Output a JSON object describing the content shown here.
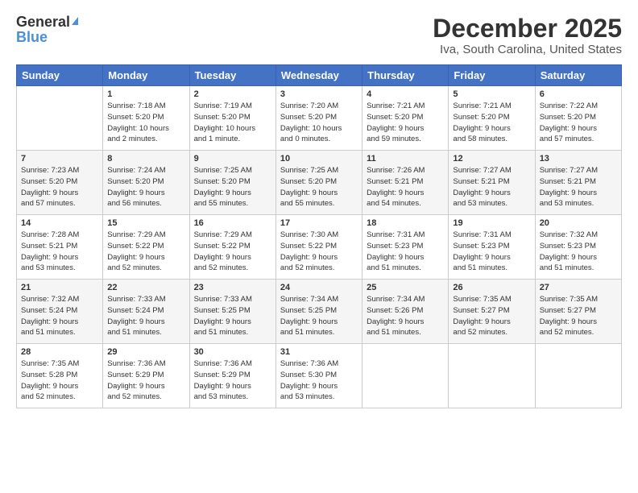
{
  "logo": {
    "general": "General",
    "blue": "Blue"
  },
  "title": "December 2025",
  "location": "Iva, South Carolina, United States",
  "days_of_week": [
    "Sunday",
    "Monday",
    "Tuesday",
    "Wednesday",
    "Thursday",
    "Friday",
    "Saturday"
  ],
  "weeks": [
    [
      {
        "day": "",
        "info": ""
      },
      {
        "day": "1",
        "info": "Sunrise: 7:18 AM\nSunset: 5:20 PM\nDaylight: 10 hours\nand 2 minutes."
      },
      {
        "day": "2",
        "info": "Sunrise: 7:19 AM\nSunset: 5:20 PM\nDaylight: 10 hours\nand 1 minute."
      },
      {
        "day": "3",
        "info": "Sunrise: 7:20 AM\nSunset: 5:20 PM\nDaylight: 10 hours\nand 0 minutes."
      },
      {
        "day": "4",
        "info": "Sunrise: 7:21 AM\nSunset: 5:20 PM\nDaylight: 9 hours\nand 59 minutes."
      },
      {
        "day": "5",
        "info": "Sunrise: 7:21 AM\nSunset: 5:20 PM\nDaylight: 9 hours\nand 58 minutes."
      },
      {
        "day": "6",
        "info": "Sunrise: 7:22 AM\nSunset: 5:20 PM\nDaylight: 9 hours\nand 57 minutes."
      }
    ],
    [
      {
        "day": "7",
        "info": "Sunrise: 7:23 AM\nSunset: 5:20 PM\nDaylight: 9 hours\nand 57 minutes."
      },
      {
        "day": "8",
        "info": "Sunrise: 7:24 AM\nSunset: 5:20 PM\nDaylight: 9 hours\nand 56 minutes."
      },
      {
        "day": "9",
        "info": "Sunrise: 7:25 AM\nSunset: 5:20 PM\nDaylight: 9 hours\nand 55 minutes."
      },
      {
        "day": "10",
        "info": "Sunrise: 7:25 AM\nSunset: 5:20 PM\nDaylight: 9 hours\nand 55 minutes."
      },
      {
        "day": "11",
        "info": "Sunrise: 7:26 AM\nSunset: 5:21 PM\nDaylight: 9 hours\nand 54 minutes."
      },
      {
        "day": "12",
        "info": "Sunrise: 7:27 AM\nSunset: 5:21 PM\nDaylight: 9 hours\nand 53 minutes."
      },
      {
        "day": "13",
        "info": "Sunrise: 7:27 AM\nSunset: 5:21 PM\nDaylight: 9 hours\nand 53 minutes."
      }
    ],
    [
      {
        "day": "14",
        "info": "Sunrise: 7:28 AM\nSunset: 5:21 PM\nDaylight: 9 hours\nand 53 minutes."
      },
      {
        "day": "15",
        "info": "Sunrise: 7:29 AM\nSunset: 5:22 PM\nDaylight: 9 hours\nand 52 minutes."
      },
      {
        "day": "16",
        "info": "Sunrise: 7:29 AM\nSunset: 5:22 PM\nDaylight: 9 hours\nand 52 minutes."
      },
      {
        "day": "17",
        "info": "Sunrise: 7:30 AM\nSunset: 5:22 PM\nDaylight: 9 hours\nand 52 minutes."
      },
      {
        "day": "18",
        "info": "Sunrise: 7:31 AM\nSunset: 5:23 PM\nDaylight: 9 hours\nand 51 minutes."
      },
      {
        "day": "19",
        "info": "Sunrise: 7:31 AM\nSunset: 5:23 PM\nDaylight: 9 hours\nand 51 minutes."
      },
      {
        "day": "20",
        "info": "Sunrise: 7:32 AM\nSunset: 5:23 PM\nDaylight: 9 hours\nand 51 minutes."
      }
    ],
    [
      {
        "day": "21",
        "info": "Sunrise: 7:32 AM\nSunset: 5:24 PM\nDaylight: 9 hours\nand 51 minutes."
      },
      {
        "day": "22",
        "info": "Sunrise: 7:33 AM\nSunset: 5:24 PM\nDaylight: 9 hours\nand 51 minutes."
      },
      {
        "day": "23",
        "info": "Sunrise: 7:33 AM\nSunset: 5:25 PM\nDaylight: 9 hours\nand 51 minutes."
      },
      {
        "day": "24",
        "info": "Sunrise: 7:34 AM\nSunset: 5:25 PM\nDaylight: 9 hours\nand 51 minutes."
      },
      {
        "day": "25",
        "info": "Sunrise: 7:34 AM\nSunset: 5:26 PM\nDaylight: 9 hours\nand 51 minutes."
      },
      {
        "day": "26",
        "info": "Sunrise: 7:35 AM\nSunset: 5:27 PM\nDaylight: 9 hours\nand 52 minutes."
      },
      {
        "day": "27",
        "info": "Sunrise: 7:35 AM\nSunset: 5:27 PM\nDaylight: 9 hours\nand 52 minutes."
      }
    ],
    [
      {
        "day": "28",
        "info": "Sunrise: 7:35 AM\nSunset: 5:28 PM\nDaylight: 9 hours\nand 52 minutes."
      },
      {
        "day": "29",
        "info": "Sunrise: 7:36 AM\nSunset: 5:29 PM\nDaylight: 9 hours\nand 52 minutes."
      },
      {
        "day": "30",
        "info": "Sunrise: 7:36 AM\nSunset: 5:29 PM\nDaylight: 9 hours\nand 53 minutes."
      },
      {
        "day": "31",
        "info": "Sunrise: 7:36 AM\nSunset: 5:30 PM\nDaylight: 9 hours\nand 53 minutes."
      },
      {
        "day": "",
        "info": ""
      },
      {
        "day": "",
        "info": ""
      },
      {
        "day": "",
        "info": ""
      }
    ]
  ]
}
